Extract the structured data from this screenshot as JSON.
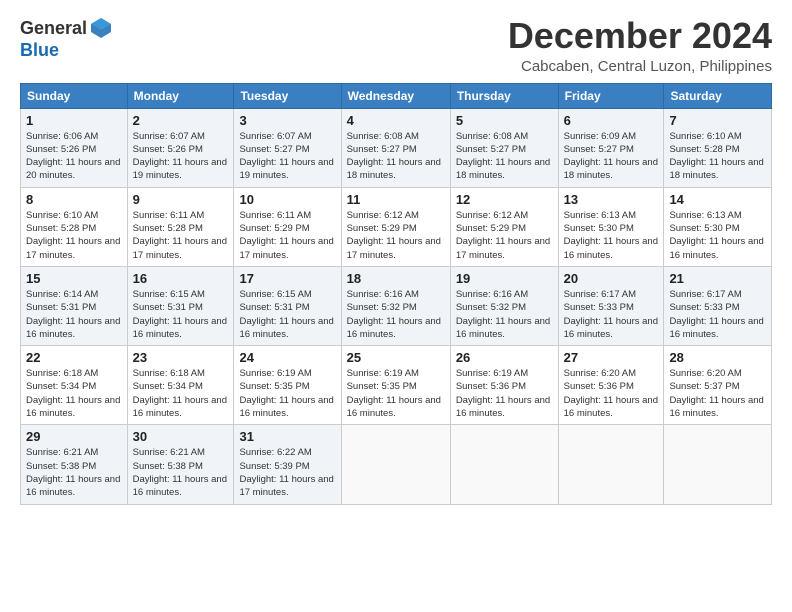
{
  "logo": {
    "general": "General",
    "blue": "Blue"
  },
  "title": "December 2024",
  "location": "Cabcaben, Central Luzon, Philippines",
  "days_header": [
    "Sunday",
    "Monday",
    "Tuesday",
    "Wednesday",
    "Thursday",
    "Friday",
    "Saturday"
  ],
  "weeks": [
    [
      {
        "day": "1",
        "sunrise": "Sunrise: 6:06 AM",
        "sunset": "Sunset: 5:26 PM",
        "daylight": "Daylight: 11 hours and 20 minutes."
      },
      {
        "day": "2",
        "sunrise": "Sunrise: 6:07 AM",
        "sunset": "Sunset: 5:26 PM",
        "daylight": "Daylight: 11 hours and 19 minutes."
      },
      {
        "day": "3",
        "sunrise": "Sunrise: 6:07 AM",
        "sunset": "Sunset: 5:27 PM",
        "daylight": "Daylight: 11 hours and 19 minutes."
      },
      {
        "day": "4",
        "sunrise": "Sunrise: 6:08 AM",
        "sunset": "Sunset: 5:27 PM",
        "daylight": "Daylight: 11 hours and 18 minutes."
      },
      {
        "day": "5",
        "sunrise": "Sunrise: 6:08 AM",
        "sunset": "Sunset: 5:27 PM",
        "daylight": "Daylight: 11 hours and 18 minutes."
      },
      {
        "day": "6",
        "sunrise": "Sunrise: 6:09 AM",
        "sunset": "Sunset: 5:27 PM",
        "daylight": "Daylight: 11 hours and 18 minutes."
      },
      {
        "day": "7",
        "sunrise": "Sunrise: 6:10 AM",
        "sunset": "Sunset: 5:28 PM",
        "daylight": "Daylight: 11 hours and 18 minutes."
      }
    ],
    [
      {
        "day": "8",
        "sunrise": "Sunrise: 6:10 AM",
        "sunset": "Sunset: 5:28 PM",
        "daylight": "Daylight: 11 hours and 17 minutes."
      },
      {
        "day": "9",
        "sunrise": "Sunrise: 6:11 AM",
        "sunset": "Sunset: 5:28 PM",
        "daylight": "Daylight: 11 hours and 17 minutes."
      },
      {
        "day": "10",
        "sunrise": "Sunrise: 6:11 AM",
        "sunset": "Sunset: 5:29 PM",
        "daylight": "Daylight: 11 hours and 17 minutes."
      },
      {
        "day": "11",
        "sunrise": "Sunrise: 6:12 AM",
        "sunset": "Sunset: 5:29 PM",
        "daylight": "Daylight: 11 hours and 17 minutes."
      },
      {
        "day": "12",
        "sunrise": "Sunrise: 6:12 AM",
        "sunset": "Sunset: 5:29 PM",
        "daylight": "Daylight: 11 hours and 17 minutes."
      },
      {
        "day": "13",
        "sunrise": "Sunrise: 6:13 AM",
        "sunset": "Sunset: 5:30 PM",
        "daylight": "Daylight: 11 hours and 16 minutes."
      },
      {
        "day": "14",
        "sunrise": "Sunrise: 6:13 AM",
        "sunset": "Sunset: 5:30 PM",
        "daylight": "Daylight: 11 hours and 16 minutes."
      }
    ],
    [
      {
        "day": "15",
        "sunrise": "Sunrise: 6:14 AM",
        "sunset": "Sunset: 5:31 PM",
        "daylight": "Daylight: 11 hours and 16 minutes."
      },
      {
        "day": "16",
        "sunrise": "Sunrise: 6:15 AM",
        "sunset": "Sunset: 5:31 PM",
        "daylight": "Daylight: 11 hours and 16 minutes."
      },
      {
        "day": "17",
        "sunrise": "Sunrise: 6:15 AM",
        "sunset": "Sunset: 5:31 PM",
        "daylight": "Daylight: 11 hours and 16 minutes."
      },
      {
        "day": "18",
        "sunrise": "Sunrise: 6:16 AM",
        "sunset": "Sunset: 5:32 PM",
        "daylight": "Daylight: 11 hours and 16 minutes."
      },
      {
        "day": "19",
        "sunrise": "Sunrise: 6:16 AM",
        "sunset": "Sunset: 5:32 PM",
        "daylight": "Daylight: 11 hours and 16 minutes."
      },
      {
        "day": "20",
        "sunrise": "Sunrise: 6:17 AM",
        "sunset": "Sunset: 5:33 PM",
        "daylight": "Daylight: 11 hours and 16 minutes."
      },
      {
        "day": "21",
        "sunrise": "Sunrise: 6:17 AM",
        "sunset": "Sunset: 5:33 PM",
        "daylight": "Daylight: 11 hours and 16 minutes."
      }
    ],
    [
      {
        "day": "22",
        "sunrise": "Sunrise: 6:18 AM",
        "sunset": "Sunset: 5:34 PM",
        "daylight": "Daylight: 11 hours and 16 minutes."
      },
      {
        "day": "23",
        "sunrise": "Sunrise: 6:18 AM",
        "sunset": "Sunset: 5:34 PM",
        "daylight": "Daylight: 11 hours and 16 minutes."
      },
      {
        "day": "24",
        "sunrise": "Sunrise: 6:19 AM",
        "sunset": "Sunset: 5:35 PM",
        "daylight": "Daylight: 11 hours and 16 minutes."
      },
      {
        "day": "25",
        "sunrise": "Sunrise: 6:19 AM",
        "sunset": "Sunset: 5:35 PM",
        "daylight": "Daylight: 11 hours and 16 minutes."
      },
      {
        "day": "26",
        "sunrise": "Sunrise: 6:19 AM",
        "sunset": "Sunset: 5:36 PM",
        "daylight": "Daylight: 11 hours and 16 minutes."
      },
      {
        "day": "27",
        "sunrise": "Sunrise: 6:20 AM",
        "sunset": "Sunset: 5:36 PM",
        "daylight": "Daylight: 11 hours and 16 minutes."
      },
      {
        "day": "28",
        "sunrise": "Sunrise: 6:20 AM",
        "sunset": "Sunset: 5:37 PM",
        "daylight": "Daylight: 11 hours and 16 minutes."
      }
    ],
    [
      {
        "day": "29",
        "sunrise": "Sunrise: 6:21 AM",
        "sunset": "Sunset: 5:38 PM",
        "daylight": "Daylight: 11 hours and 16 minutes."
      },
      {
        "day": "30",
        "sunrise": "Sunrise: 6:21 AM",
        "sunset": "Sunset: 5:38 PM",
        "daylight": "Daylight: 11 hours and 16 minutes."
      },
      {
        "day": "31",
        "sunrise": "Sunrise: 6:22 AM",
        "sunset": "Sunset: 5:39 PM",
        "daylight": "Daylight: 11 hours and 17 minutes."
      },
      null,
      null,
      null,
      null
    ]
  ]
}
